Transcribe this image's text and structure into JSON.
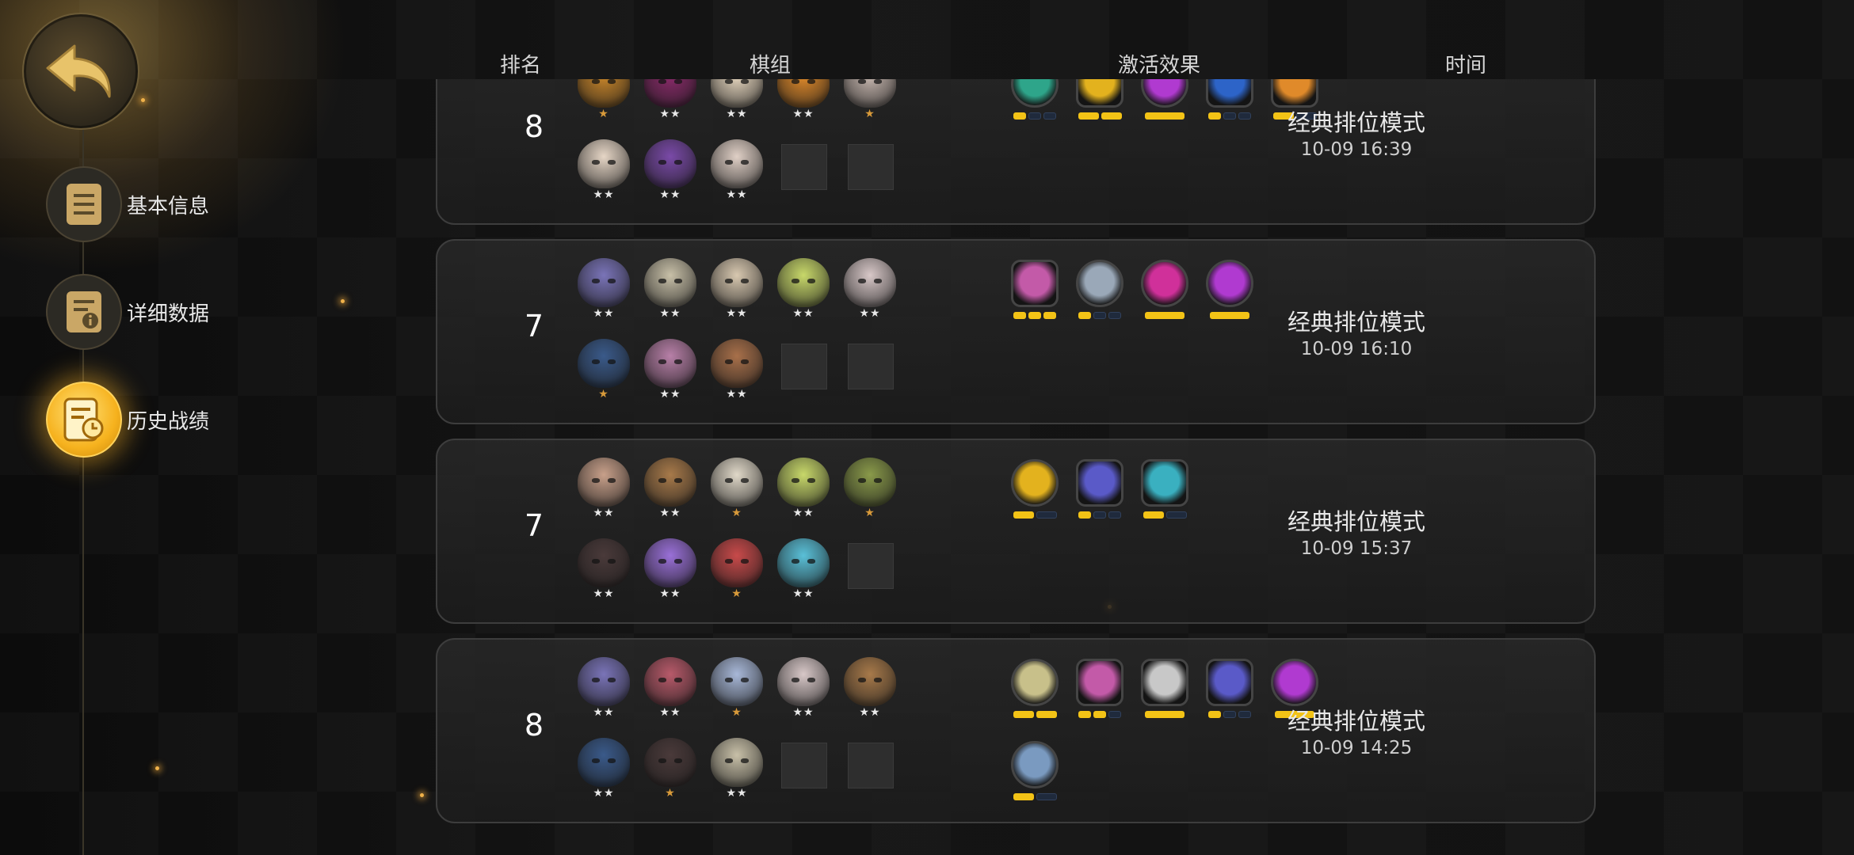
{
  "header": {
    "rank": "排名",
    "lineup": "棋组",
    "synergy": "激活效果",
    "time": "时间"
  },
  "sidebar": {
    "items": [
      {
        "label": "基本信息",
        "icon": "document-icon",
        "active": false
      },
      {
        "label": "详细数据",
        "icon": "document-info-icon",
        "active": false
      },
      {
        "label": "历史战绩",
        "icon": "history-record-icon",
        "active": true
      }
    ]
  },
  "colors": {
    "accent": "#f3c316",
    "active_nav": "#f6b21e",
    "bar_off": "#1f2a3c"
  },
  "matches": [
    {
      "rank": "8",
      "mode": "经典排位模式",
      "time": "10-09 16:39",
      "pieces_row1": [
        {
          "color": "#c9862a",
          "stars": 1
        },
        {
          "color": "#8a2a6a",
          "stars": 2
        },
        {
          "color": "#e8d8c0",
          "stars": 2
        },
        {
          "color": "#e08a2a",
          "stars": 2
        },
        {
          "color": "#c8b8b0",
          "stars": 1
        }
      ],
      "pieces_row2": [
        {
          "color": "#e6d6c6",
          "stars": 2
        },
        {
          "color": "#7a4aa8",
          "stars": 2
        },
        {
          "color": "#e0d0c6",
          "stars": 2
        },
        null,
        null
      ],
      "synergies": [
        {
          "color": "#2ea58a",
          "bars": [
            1,
            0,
            0
          ],
          "shape": "circle"
        },
        {
          "color": "#e3b21e",
          "bars": [
            1,
            1
          ],
          "shape": "hex"
        },
        {
          "color": "#b03ad0",
          "bars": [
            1
          ],
          "shape": "circle"
        },
        {
          "color": "#2d64c8",
          "bars": [
            1,
            0,
            0
          ],
          "shape": "hex"
        },
        {
          "color": "#e08a2a",
          "bars": [
            1,
            0
          ],
          "shape": "hex"
        }
      ]
    },
    {
      "rank": "7",
      "mode": "经典排位模式",
      "time": "10-09 16:10",
      "pieces_row1": [
        {
          "color": "#7a74b8",
          "stars": 2
        },
        {
          "color": "#c8c0a8",
          "stars": 2
        },
        {
          "color": "#d8c8b0",
          "stars": 2
        },
        {
          "color": "#c8d86a",
          "stars": 2
        },
        {
          "color": "#d8c8c8",
          "stars": 2
        }
      ],
      "pieces_row2": [
        {
          "color": "#3a5a8a",
          "stars": 1
        },
        {
          "color": "#b880a8",
          "stars": 2
        },
        {
          "color": "#a8704a",
          "stars": 2
        },
        null,
        null
      ],
      "synergies": [
        {
          "color": "#c35aa8",
          "bars": [
            1,
            1,
            1
          ],
          "shape": "hex"
        },
        {
          "color": "#9aa8b8",
          "bars": [
            1,
            0,
            0
          ],
          "shape": "circle"
        },
        {
          "color": "#d0309a",
          "bars": [
            1
          ],
          "shape": "circle"
        },
        {
          "color": "#b03ad0",
          "bars": [
            1
          ],
          "shape": "circle"
        }
      ]
    },
    {
      "rank": "7",
      "mode": "经典排位模式",
      "time": "10-09 15:37",
      "pieces_row1": [
        {
          "color": "#c8a08a",
          "stars": 2
        },
        {
          "color": "#a87a4a",
          "stars": 2
        },
        {
          "color": "#e0d8c8",
          "stars": 1
        },
        {
          "color": "#c8d86a",
          "stars": 2
        },
        {
          "color": "#8a9a4a",
          "stars": 1
        }
      ],
      "pieces_row2": [
        {
          "color": "#4a3a3a",
          "stars": 2
        },
        {
          "color": "#9a70d8",
          "stars": 2
        },
        {
          "color": "#c84a4a",
          "stars": 1
        },
        {
          "color": "#5ac0d8",
          "stars": 2
        },
        null
      ],
      "synergies": [
        {
          "color": "#e3b21e",
          "bars": [
            1,
            0
          ],
          "shape": "circle"
        },
        {
          "color": "#5a5ac8",
          "bars": [
            1,
            0,
            0
          ],
          "shape": "hex"
        },
        {
          "color": "#3ab0c0",
          "bars": [
            1,
            0
          ],
          "shape": "hex"
        }
      ]
    },
    {
      "rank": "8",
      "mode": "经典排位模式",
      "time": "10-09 14:25",
      "pieces_row1": [
        {
          "color": "#7a74b8",
          "stars": 2
        },
        {
          "color": "#b85a6a",
          "stars": 2
        },
        {
          "color": "#a8b8d8",
          "stars": 1
        },
        {
          "color": "#d8c8c8",
          "stars": 2
        },
        {
          "color": "#a87a4a",
          "stars": 2
        }
      ],
      "pieces_row2": [
        {
          "color": "#3a5a8a",
          "stars": 2
        },
        {
          "color": "#4a3a3a",
          "stars": 1
        },
        {
          "color": "#c8c0a8",
          "stars": 2
        },
        null,
        null
      ],
      "synergies": [
        {
          "color": "#c8c08a",
          "bars": [
            1,
            1
          ],
          "shape": "circle"
        },
        {
          "color": "#c35aa8",
          "bars": [
            1,
            1,
            0
          ],
          "shape": "hex"
        },
        {
          "color": "#c8c8c8",
          "bars": [
            1
          ],
          "shape": "hex"
        },
        {
          "color": "#5a5ac8",
          "bars": [
            1,
            0,
            0
          ],
          "shape": "hex"
        },
        {
          "color": "#b03ad0",
          "bars": [
            1
          ],
          "shape": "circle"
        },
        {
          "color": "#7a9ac0",
          "bars": [
            1,
            0
          ],
          "shape": "circle"
        }
      ]
    }
  ]
}
